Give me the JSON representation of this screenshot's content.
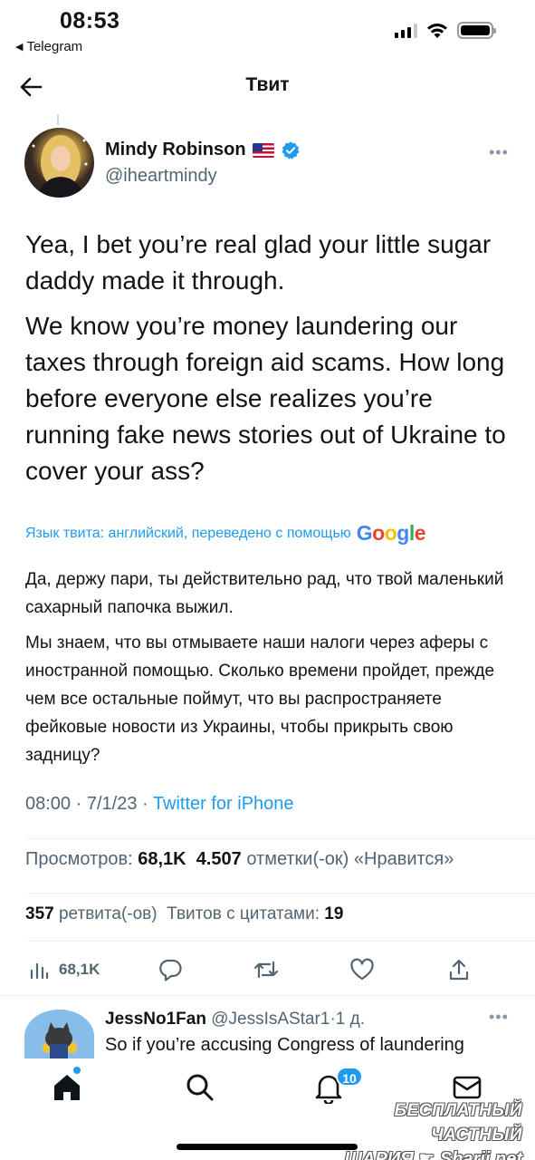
{
  "status_bar": {
    "time": "08:53",
    "back_app": "Telegram",
    "back_icon": "back-triangle-icon"
  },
  "header": {
    "title": "Твит"
  },
  "tweet": {
    "author_name": "Mindy Robinson",
    "author_handle": "@iheartmindy",
    "flag": "us-flag-icon",
    "more_label": "•••",
    "text_paragraphs": [
      "Yea, I bet you’re real glad your little sugar daddy made it through.",
      "We know you’re money laundering our taxes through foreign aid scams. How long before everyone else realizes you’re running fake news stories out of Ukraine to cover your ass?"
    ],
    "translated_label": "Язык твита: английский, переведено с помощью",
    "google_letters": [
      "G",
      "o",
      "o",
      "g",
      "l",
      "e"
    ],
    "translation_paragraphs": [
      "Да, держу пари, ты действительно рад, что твой маленький сахарный папочка выжил.",
      "Мы знаем, что вы отмываете наши налоги через аферы с иностранной помощью. Сколько времени пройдет, прежде чем все остальные поймут, что вы распространяете фейковые новости из Украины, чтобы прикрыть свою задницу?"
    ],
    "time": "08:00",
    "date": "7/1/23",
    "separator": "·",
    "source": "Twitter for iPhone",
    "views_label": "Просмотров:",
    "views_count": "68,1K",
    "likes_count": "4.507",
    "likes_label": "отметки(-ок) «Нравится»",
    "retweets_count": "357",
    "retweets_label": "ретвита(-ов)",
    "quotes_label": "Твитов с цитатами:",
    "quotes_count": "19"
  },
  "actions": {
    "views_count": "68,1K"
  },
  "reply": {
    "author_name": "JessNo1Fan",
    "author_handle": "@JessIsAStar1",
    "time": "1 д.",
    "separator": "·",
    "text": "So if you’re accusing Congress of laundering"
  },
  "tab_bar": {
    "items": [
      "home-icon",
      "search-icon",
      "bell-icon",
      "mail-icon"
    ],
    "notifications_badge": "10"
  },
  "watermark": {
    "line1": "БЕСПЛАТНЫЙ ЧАСТНЫЙ",
    "line2_left": "ШАРИЯ",
    "line2_right": "Sharij.net"
  },
  "colors": {
    "accent": "#1d9bf0",
    "text_primary": "#0f1419",
    "text_secondary": "#536471"
  }
}
